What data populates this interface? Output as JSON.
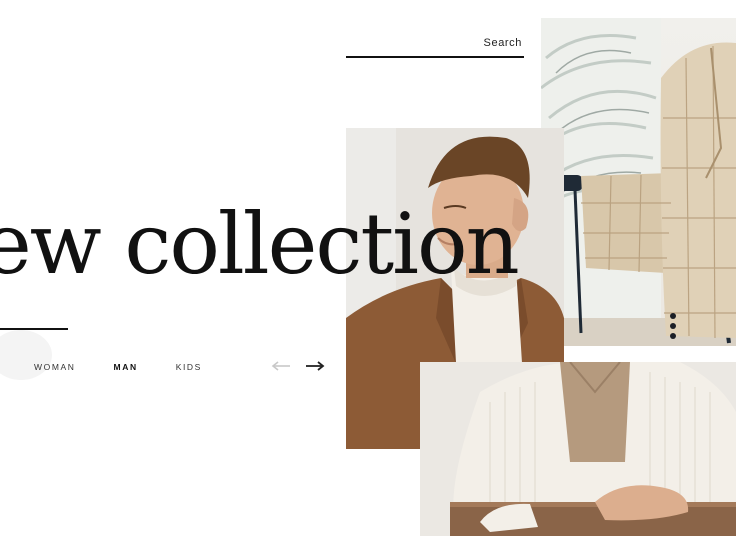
{
  "search": {
    "label": "Search"
  },
  "hero": {
    "title": "ew collection"
  },
  "nav": {
    "items": [
      {
        "label": "WOMAN",
        "active": false
      },
      {
        "label": "MAN",
        "active": true
      },
      {
        "label": "KIDS",
        "active": false
      }
    ]
  },
  "icons": {
    "prev": "arrow-left-icon",
    "next": "arrow-right-icon"
  },
  "colors": {
    "text": "#111111",
    "coat": "#8a5a36",
    "plaid": "#d9c8ad",
    "cream": "#f3efe8",
    "background": "#ffffff"
  }
}
